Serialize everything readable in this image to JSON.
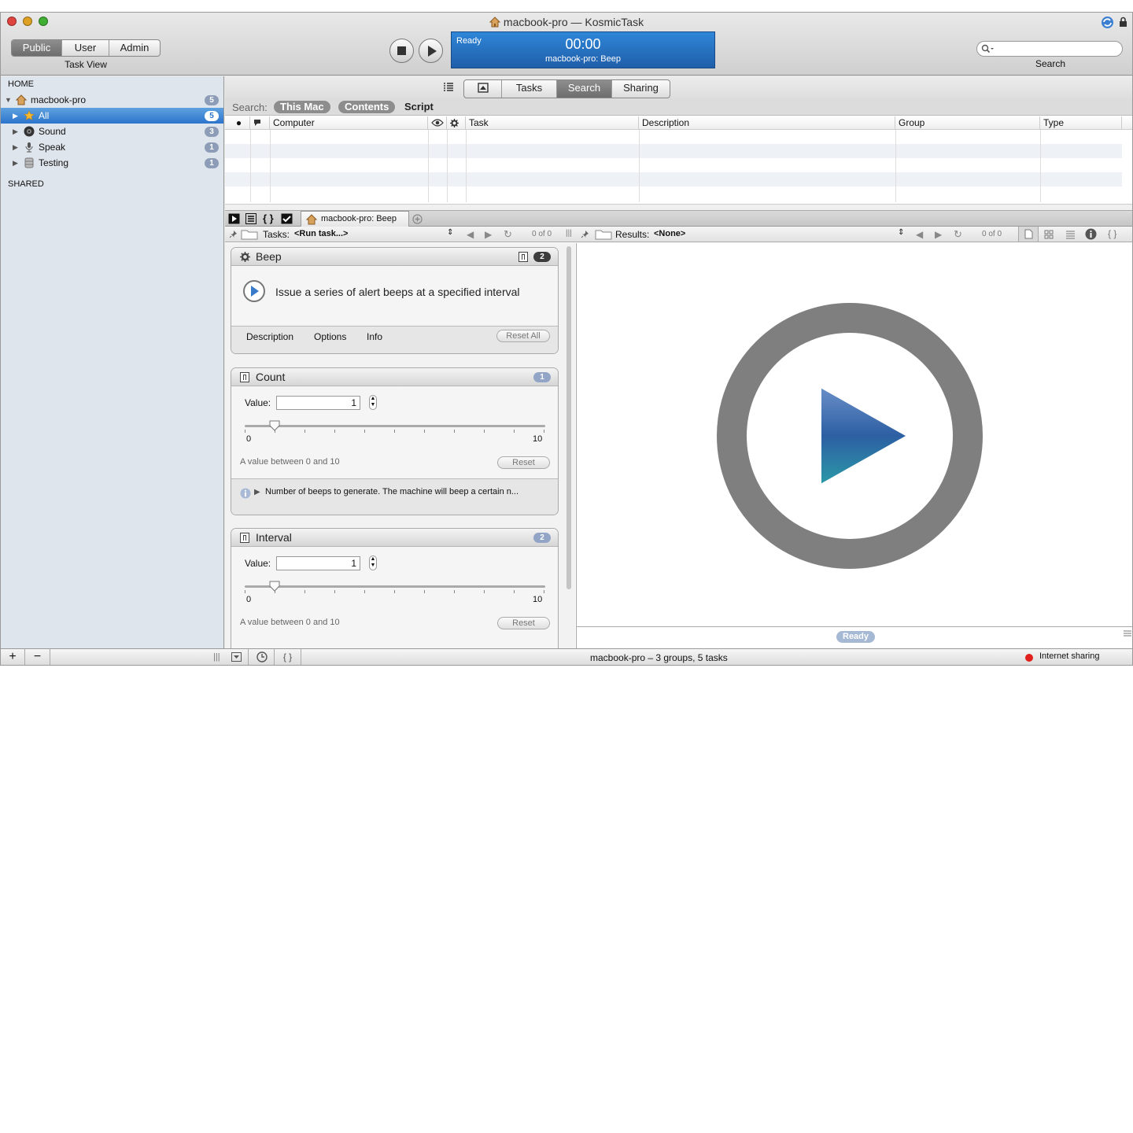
{
  "window": {
    "title": "macbook-pro — KosmicTask"
  },
  "toolbar": {
    "view_segments": [
      "Public",
      "User",
      "Admin"
    ],
    "view_selected": "Public",
    "view_label": "Task View",
    "lcd": {
      "status": "Ready",
      "time": "00:00",
      "task": "macbook-pro: Beep"
    },
    "search_label": "Search",
    "search_placeholder": ""
  },
  "sidebar": {
    "home_header": "HOME",
    "host": {
      "label": "macbook-pro",
      "count": "5"
    },
    "items": [
      {
        "label": "All",
        "count": "5",
        "icon": "star-icon"
      },
      {
        "label": "Sound",
        "count": "3",
        "icon": "speaker-icon"
      },
      {
        "label": "Speak",
        "count": "1",
        "icon": "microphone-icon"
      },
      {
        "label": "Testing",
        "count": "1",
        "icon": "database-icon"
      }
    ],
    "shared_header": "SHARED"
  },
  "main": {
    "tabs": [
      "Tasks",
      "Search",
      "Sharing"
    ],
    "tab_selected": "Search",
    "scope_label": "Search:",
    "scopes": [
      "This Mac",
      "Contents",
      "Script"
    ],
    "columns": [
      "Computer",
      "Task",
      "Description",
      "Group",
      "Type"
    ],
    "doc_tab": "macbook-pro: Beep",
    "tasks_label": "Tasks:",
    "tasks_value": "<Run task...>",
    "tasks_count": "0 of 0",
    "results_label": "Results:",
    "results_value": "<None>",
    "results_count": "0 of 0"
  },
  "beep_card": {
    "title": "Beep",
    "badge": "2",
    "description": "Issue a series of alert beeps at a specified interval",
    "tabs": [
      "Description",
      "Options",
      "Info"
    ],
    "reset_all": "Reset All"
  },
  "count_card": {
    "title": "Count",
    "badge": "1",
    "value_label": "Value:",
    "value": "1",
    "min": "0",
    "max": "10",
    "slider_value": 1,
    "range_text": "A value between 0 and 10",
    "reset": "Reset",
    "info": "Number of beeps to generate. The machine will beep a certain n..."
  },
  "interval_card": {
    "title": "Interval",
    "badge": "2",
    "value_label": "Value:",
    "value": "1",
    "min": "0",
    "max": "10",
    "slider_value": 1,
    "range_text": "A value between 0 and 10",
    "reset": "Reset"
  },
  "results": {
    "status": "Ready"
  },
  "status": {
    "summary": "macbook-pro – 3 groups, 5 tasks",
    "sharing": "Internet sharing",
    "sharing_color": "#e0201b"
  },
  "colors": {
    "accent": "#2b74cc",
    "lcd": "#2f86d8",
    "play_ring": "#7f7f7f",
    "play_triangle": "#2d5fa3"
  }
}
